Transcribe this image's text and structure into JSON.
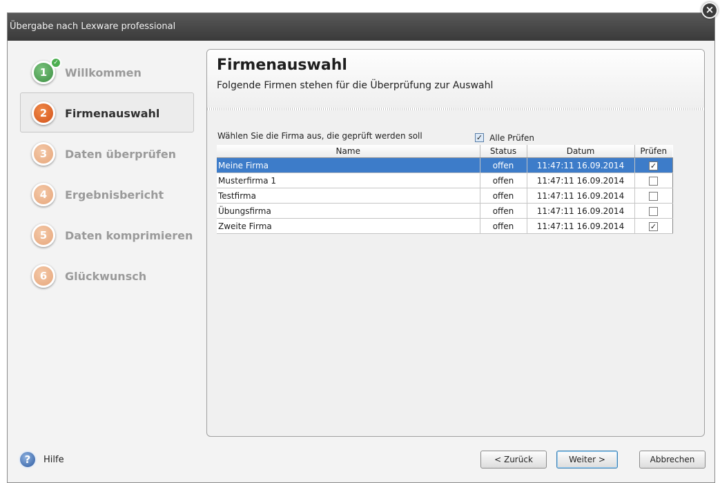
{
  "window": {
    "title": "Übergabe nach Lexware professional",
    "close_glyph": "×"
  },
  "sidebar": {
    "items": [
      {
        "number": "1",
        "label": "Willkommen",
        "state": "done"
      },
      {
        "number": "2",
        "label": "Firmenauswahl",
        "state": "active"
      },
      {
        "number": "3",
        "label": "Daten überprüfen",
        "state": "pending"
      },
      {
        "number": "4",
        "label": "Ergebnisbericht",
        "state": "pending"
      },
      {
        "number": "5",
        "label": "Daten komprimieren",
        "state": "pending"
      },
      {
        "number": "6",
        "label": "Glückwunsch",
        "state": "pending"
      }
    ],
    "check_glyph": "✓"
  },
  "content": {
    "title": "Firmenauswahl",
    "subtitle": "Folgende Firmen stehen für die Überprüfung zur Auswahl",
    "instruction": "Wählen Sie die Firma aus, die geprüft werden soll",
    "select_all": {
      "label": "Alle Prüfen",
      "checked": true
    },
    "table": {
      "headers": {
        "name": "Name",
        "status": "Status",
        "date": "Datum",
        "check": "Prüfen"
      },
      "rows": [
        {
          "name": "Meine Firma",
          "status": "offen",
          "date": "11:47:11 16.09.2014",
          "checked": true,
          "selected": true
        },
        {
          "name": "Musterfirma 1",
          "status": "offen",
          "date": "11:47:11 16.09.2014",
          "checked": false,
          "selected": false
        },
        {
          "name": "Testfirma",
          "status": "offen",
          "date": "11:47:11 16.09.2014",
          "checked": false,
          "selected": false
        },
        {
          "name": "Übungsfirma",
          "status": "offen",
          "date": "11:47:11 16.09.2014",
          "checked": false,
          "selected": false
        },
        {
          "name": "Zweite Firma",
          "status": "offen",
          "date": "11:47:11 16.09.2014",
          "checked": true,
          "selected": false
        }
      ]
    }
  },
  "footer": {
    "help_glyph": "?",
    "help_label": "Hilfe",
    "back_label": "< Zurück",
    "next_label": "Weiter >",
    "cancel_label": "Abbrechen"
  },
  "colors": {
    "step_done": "#3b8e41",
    "step_active": "#d2521a",
    "step_pending": "#e7a67a",
    "selection": "#3d7cc9",
    "titlebar": "#3a3a3a"
  },
  "icons": {
    "close": "close-icon",
    "help": "help-icon",
    "step_done_badge": "check-icon"
  }
}
